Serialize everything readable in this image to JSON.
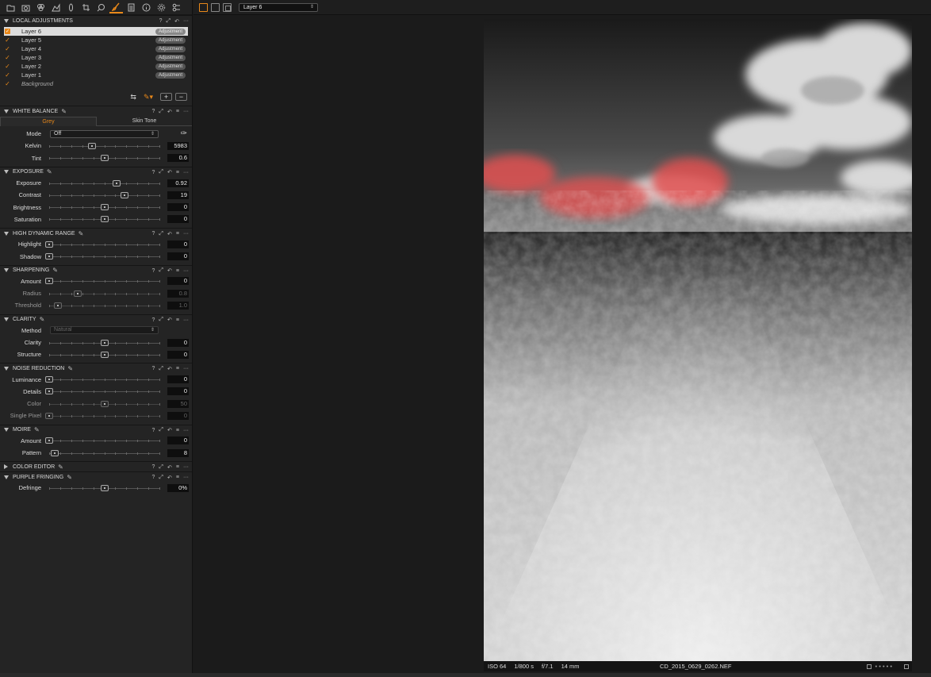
{
  "toolbar": {
    "tools": [
      "folder-icon",
      "camera-icon",
      "color-icon",
      "exposure-icon",
      "lens-icon",
      "crop-icon",
      "search-icon",
      "brush-icon",
      "metadata-icon",
      "info-icon",
      "settings-icon",
      "batch-icon"
    ],
    "active_tool": "brush-icon",
    "accent": "#e8881a"
  },
  "local_adjustments": {
    "title": "LOCAL ADJUSTMENTS",
    "layers": [
      {
        "name": "Layer 6",
        "badge": "Adjustment",
        "selected": true
      },
      {
        "name": "Layer 5",
        "badge": "Adjustment"
      },
      {
        "name": "Layer 4",
        "badge": "Adjustment"
      },
      {
        "name": "Layer 3",
        "badge": "Adjustment"
      },
      {
        "name": "Layer 2",
        "badge": "Adjustment"
      },
      {
        "name": "Layer 1",
        "badge": "Adjustment"
      },
      {
        "name": "Background",
        "badge": ""
      }
    ],
    "add_label": "+",
    "remove_label": "−"
  },
  "white_balance": {
    "title": "WHITE BALANCE",
    "tabs": [
      "Grey",
      "Skin Tone"
    ],
    "active_tab": "Grey",
    "mode_label": "Mode",
    "mode_value": "Off",
    "sliders": [
      {
        "label": "Kelvin",
        "value": "5983",
        "level": 0.39
      },
      {
        "label": "Tint",
        "value": "0.6",
        "level": 0.5
      }
    ]
  },
  "exposure": {
    "title": "EXPOSURE",
    "sliders": [
      {
        "label": "Exposure",
        "value": "0.92",
        "level": 0.61
      },
      {
        "label": "Contrast",
        "value": "19",
        "level": 0.68
      },
      {
        "label": "Brightness",
        "value": "0",
        "level": 0.5
      },
      {
        "label": "Saturation",
        "value": "0",
        "level": 0.5
      }
    ]
  },
  "hdr": {
    "title": "HIGH DYNAMIC RANGE",
    "sliders": [
      {
        "label": "Highlight",
        "value": "0",
        "level": 0
      },
      {
        "label": "Shadow",
        "value": "0",
        "level": 0
      }
    ]
  },
  "sharpening": {
    "title": "SHARPENING",
    "sliders": [
      {
        "label": "Amount",
        "value": "0",
        "level": 0,
        "disabled": false
      },
      {
        "label": "Radius",
        "value": "0.8",
        "level": 0.26,
        "disabled": true
      },
      {
        "label": "Threshold",
        "value": "1.0",
        "level": 0.08,
        "disabled": true
      }
    ]
  },
  "clarity": {
    "title": "CLARITY",
    "method_label": "Method",
    "method_value": "Natural",
    "sliders": [
      {
        "label": "Clarity",
        "value": "0",
        "level": 0.5
      },
      {
        "label": "Structure",
        "value": "0",
        "level": 0.5
      }
    ]
  },
  "noise_reduction": {
    "title": "NOISE REDUCTION",
    "sliders": [
      {
        "label": "Luminance",
        "value": "0",
        "level": 0,
        "disabled": false
      },
      {
        "label": "Details",
        "value": "0",
        "level": 0,
        "disabled": false
      },
      {
        "label": "Color",
        "value": "50",
        "level": 0.5,
        "disabled": true
      },
      {
        "label": "Single Pixel",
        "value": "0",
        "level": 0,
        "disabled": true
      }
    ]
  },
  "moire": {
    "title": "MOIRE",
    "sliders": [
      {
        "label": "Amount",
        "value": "0",
        "level": 0
      },
      {
        "label": "Pattern",
        "value": "8",
        "level": 0.05
      }
    ]
  },
  "color_editor": {
    "title": "COLOR EDITOR"
  },
  "purple_fringing": {
    "title": "PURPLE FRINGING",
    "sliders": [
      {
        "label": "Defringe",
        "value": "0%",
        "level": 0.5
      }
    ]
  },
  "viewer": {
    "layer_select": "Layer 6",
    "info": {
      "iso": "ISO 64",
      "shutter": "1/800 s",
      "aperture": "f/7.1",
      "focal": "14 mm",
      "filename": "CD_2015_0629_0262.NEF"
    },
    "mask_color": "#e05050"
  }
}
